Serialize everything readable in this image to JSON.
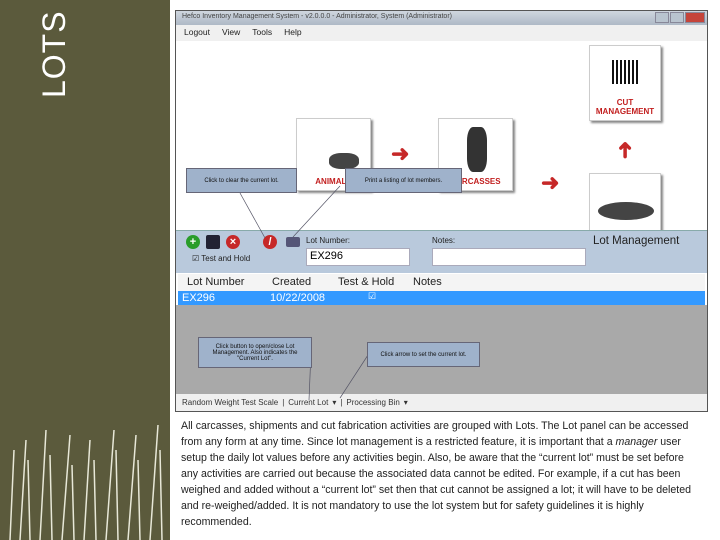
{
  "slide": {
    "title": "LOTS",
    "body_parts": [
      "All carcasses, shipments and cut fabrication activities are grouped with Lots. The Lot panel can be accessed from any form at any time. Since lot management is a restricted feature, it is important that a ",
      "manager",
      " user setup the daily lot values before any activities begin. Also, be aware that the “current lot” must be set before any activities are carried out because the associated data cannot be edited. For example, if a cut has been weighed and added without a “current lot” set then that cut cannot be assigned a lot; it will have to be deleted and re-weighed/added. It is not mandatory to use the lot system but for safety guidelines it is highly recommended."
    ]
  },
  "window": {
    "title": "Hefco Inventory Management System - v2.0.0.0 - Administrator, System (Administrator)",
    "menu": [
      "Logout",
      "View",
      "Tools",
      "Help"
    ],
    "tiles": {
      "animals": "ANIMALS",
      "carcasses": "CARCASSES",
      "cut": "CUT MANAGEMENT"
    },
    "lot_panel": {
      "heading": "Lot Management",
      "lot_number_label": "Lot Number:",
      "lot_number_value": "EX296",
      "notes_label": "Notes:",
      "notes_value": "",
      "test_hold_label": "Test and Hold",
      "test_hold_checked": true
    },
    "table": {
      "columns": [
        "Lot Number",
        "Created",
        "Test & Hold",
        "Notes"
      ],
      "rows": [
        {
          "lot": "EX296",
          "created": "10/22/2008",
          "test_hold": true,
          "notes": ""
        }
      ]
    },
    "status": [
      "Random Weight Test Scale",
      "Current Lot",
      "Processing Bin"
    ]
  },
  "tooltips": {
    "clear": "Click to clear the current lot.",
    "print": "Print a listing of lot members.",
    "open": "Click button to open/close Lot Management. Also indicates the \"Current Lot\".",
    "arrow": "Click arrow to set the current lot."
  }
}
